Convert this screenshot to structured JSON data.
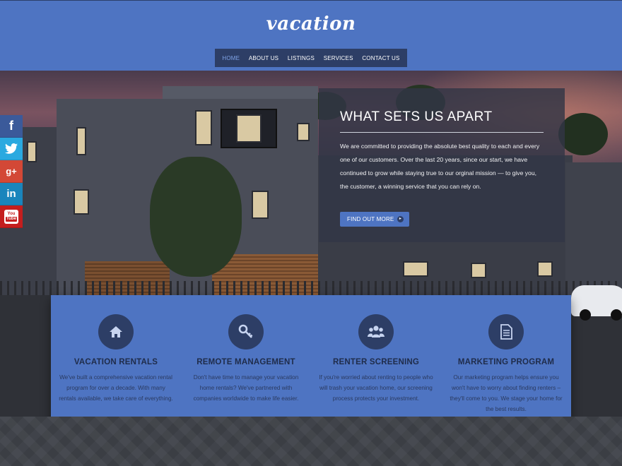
{
  "header": {
    "logo": "vacation",
    "nav": [
      {
        "label": "HOME",
        "active": true
      },
      {
        "label": "ABOUT US",
        "active": false
      },
      {
        "label": "LISTINGS",
        "active": false
      },
      {
        "label": "SERVICES",
        "active": false
      },
      {
        "label": "CONTACT US",
        "active": false
      }
    ],
    "color": "#4e74c2"
  },
  "social": [
    {
      "icon": "facebook-icon",
      "glyph": "f"
    },
    {
      "icon": "twitter-icon",
      "glyph": ""
    },
    {
      "icon": "google-plus-icon",
      "glyph": "g+"
    },
    {
      "icon": "linkedin-icon",
      "glyph": "in"
    },
    {
      "icon": "youtube-icon",
      "glyph": "You Tube"
    }
  ],
  "hero": {
    "title": "WHAT SETS US APART",
    "text": "We are committed to providing the absolute best quality to each and every one of our customers. Over the last 20 years, since our start, we have continued to grow while staying true to our orginal mission — to give you, the customer, a winning service that you can rely on.",
    "button": "FIND OUT MORE"
  },
  "features": [
    {
      "icon": "home-icon",
      "title": "VACATION RENTALS",
      "text": "We've built a comprehensive vacation rental program for over a decade. With many rentals available, we take care of everything."
    },
    {
      "icon": "key-icon",
      "title": "REMOTE MANAGEMENT",
      "text": "Don't have time to manage your vacation home rentals? We've partnered with companies worldwide to make life easier."
    },
    {
      "icon": "users-icon",
      "title": "RENTER SCREENING",
      "text": "If you're worried about renting to people who will trash your vacation home, our screening process protects your investment."
    },
    {
      "icon": "document-icon",
      "title": "MARKETING PROGRAM",
      "text": "Our marketing program helps ensure you won't have to worry about finding renters – they'll come to you. We stage your home for the best results."
    }
  ]
}
